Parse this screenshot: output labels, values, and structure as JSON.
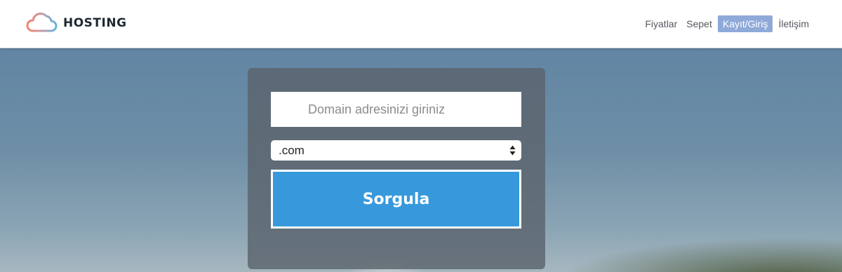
{
  "brand": {
    "name": "HOSTING",
    "logo_icon": "cloud-icon"
  },
  "nav": {
    "items": [
      {
        "label": "Fiyatlar",
        "active": false
      },
      {
        "label": "Sepet",
        "active": false
      },
      {
        "label": "Kayıt/Giriş",
        "active": true
      },
      {
        "label": "İletişim",
        "active": false
      }
    ],
    "active_color": "#8fa9d9"
  },
  "search": {
    "placeholder": "Domain adresinizi giriniz",
    "value": "",
    "tld_selected": ".com",
    "submit_label": "Sorgula",
    "submit_color": "#3799dc"
  }
}
